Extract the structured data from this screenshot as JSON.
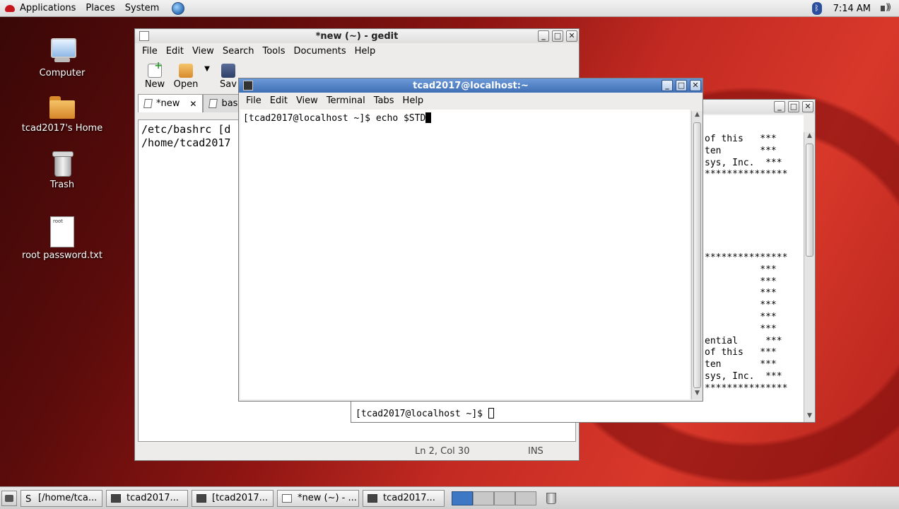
{
  "top_panel": {
    "menus": [
      "Applications",
      "Places",
      "System"
    ],
    "clock": "7:14 AM"
  },
  "desktop": {
    "icons": [
      {
        "label": "Computer"
      },
      {
        "label": "tcad2017's Home"
      },
      {
        "label": "Trash"
      },
      {
        "label": "root password.txt",
        "file_text": "root"
      }
    ]
  },
  "gedit": {
    "title": "*new (~) - gedit",
    "menu": [
      "File",
      "Edit",
      "View",
      "Search",
      "Tools",
      "Documents",
      "Help"
    ],
    "toolbar": {
      "new": "New",
      "open": "Open",
      "save": "Sav"
    },
    "tabs": [
      {
        "label": "*new"
      },
      {
        "label": "bash"
      }
    ],
    "lines": [
      "/etc/bashrc [d",
      "/home/tcad2017"
    ],
    "status": {
      "position": "Ln 2, Col 30",
      "mode": "INS"
    }
  },
  "terminal_front": {
    "title": "tcad2017@localhost:~",
    "menu": [
      "File",
      "Edit",
      "View",
      "Terminal",
      "Tabs",
      "Help"
    ],
    "prompt": "[tcad2017@localhost ~]$ echo $STD"
  },
  "terminal_back": {
    "lines": [
      "of this   ***",
      "ten       ***",
      "sys, Inc.  ***",
      "***************",
      "",
      "",
      "",
      "",
      "",
      "",
      "***************",
      "          ***",
      "          ***",
      "          ***",
      "          ***",
      "          ***",
      "          ***",
      "ential     ***",
      "of this   ***",
      "ten       ***",
      "sys, Inc.  ***",
      "***************"
    ],
    "prompt": "[tcad2017@localhost ~]$ "
  },
  "taskbar": {
    "items": [
      {
        "label": "[/home/tca..."
      },
      {
        "label": "tcad2017..."
      },
      {
        "label": "[tcad2017..."
      },
      {
        "label": "*new (~) - ..."
      },
      {
        "label": "tcad2017..."
      }
    ]
  }
}
